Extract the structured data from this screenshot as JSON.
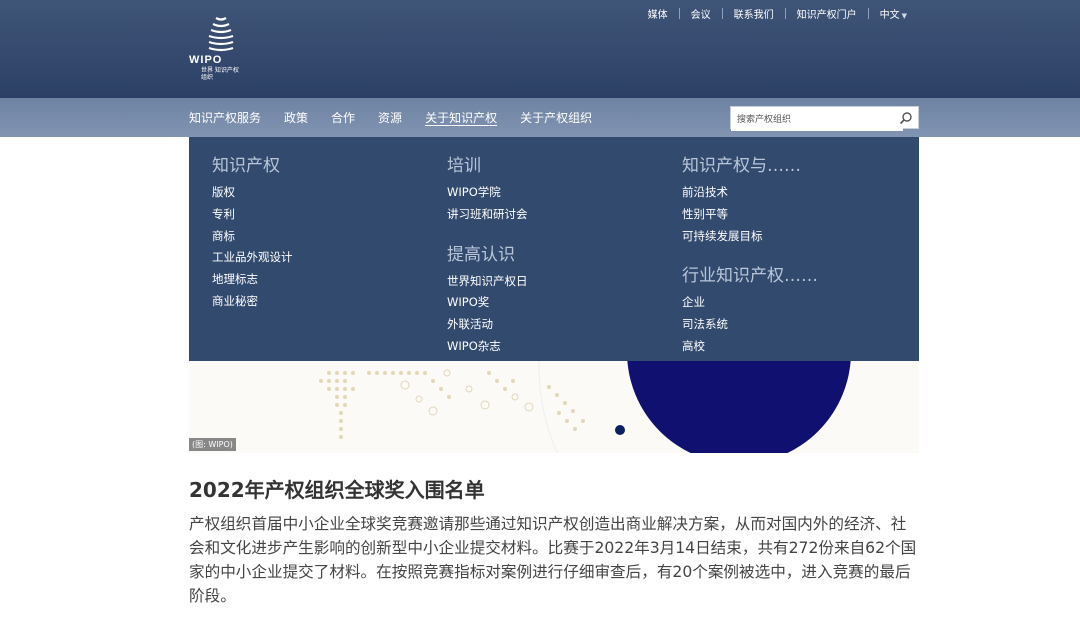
{
  "logo": {
    "word": "WIPO",
    "sub": "世界 知识产权 组织"
  },
  "top_links": [
    "媒体",
    "会议",
    "联系我们",
    "知识产权门户",
    "中文"
  ],
  "nav": [
    "知识产权服务",
    "政策",
    "合作",
    "资源",
    "关于知识产权",
    "关于产权组织"
  ],
  "search": {
    "placeholder": "搜索产权组织"
  },
  "menu": {
    "col1": {
      "heading": "知识产权",
      "items": [
        "版权",
        "专利",
        "商标",
        "工业品外观设计",
        "地理标志",
        "商业秘密"
      ]
    },
    "col2": {
      "heading": "培训",
      "items": [
        "WIPO学院",
        "讲习班和研讨会"
      ],
      "heading2": "提高认识",
      "items2": [
        "世界知识产权日",
        "WIPO奖",
        "外联活动",
        "WIPO杂志"
      ]
    },
    "col3": {
      "heading": "知识产权与……",
      "items": [
        "前沿技术",
        "性别平等",
        "可持续发展目标"
      ],
      "heading2": "行业知识产权……",
      "items2": [
        "企业",
        "司法系统",
        "高校"
      ]
    }
  },
  "image_caption": "(图: WIPO)",
  "article": {
    "title": "2022年产权组织全球奖入围名单",
    "body": "产权组织首届中小企业全球奖竞赛邀请那些通过知识产权创造出商业解决方案，从而对国内外的经济、社会和文化进步产生影响的创新型中小企业提交材料。比赛于2022年3月14日结束，共有272份来自62个国家的中小企业提交了材料。在按照竞赛指标对案例进行仔细审查后，有20个案例被选中，进入竞赛的最后阶段。"
  },
  "colors": {
    "header": "#2c4066",
    "navbar": "#7a8dab",
    "menu": "#324a6e",
    "accent": "#0a0f6e"
  }
}
